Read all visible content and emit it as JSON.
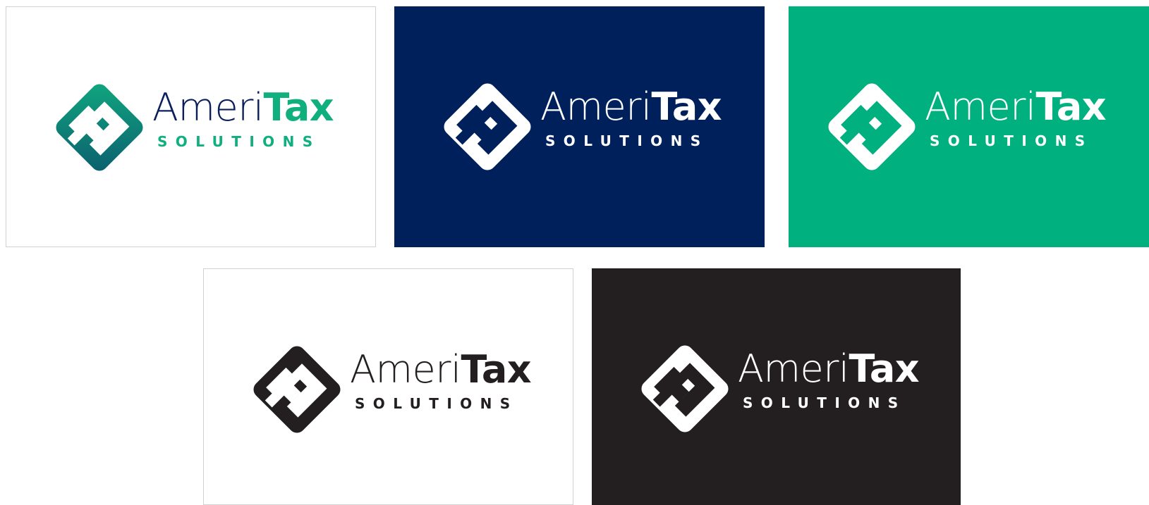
{
  "brand": {
    "name_light": "Ameri",
    "name_bold": "Tax",
    "tagline": "SOLUTIONS"
  },
  "variants": [
    {
      "id": "full-color-on-white",
      "background": "#ffffff",
      "name_light_color": "#0b1f5c",
      "name_bold_color": "#10b07e",
      "tagline_color": "#10b07e",
      "mark_style": "gradient",
      "mark_colors": [
        "#10a77f",
        "#0c5e6e"
      ]
    },
    {
      "id": "white-on-navy",
      "background": "#00205b",
      "name_light_color": "#ffffff",
      "name_bold_color": "#ffffff",
      "tagline_color": "#ffffff",
      "mark_style": "solid",
      "mark_colors": [
        "#ffffff"
      ]
    },
    {
      "id": "white-on-green",
      "background": "#00b07e",
      "name_light_color": "#ffffff",
      "name_bold_color": "#ffffff",
      "tagline_color": "#ffffff",
      "mark_style": "solid",
      "mark_colors": [
        "#ffffff"
      ]
    },
    {
      "id": "black-on-white",
      "background": "#ffffff",
      "name_light_color": "#231f20",
      "name_bold_color": "#231f20",
      "tagline_color": "#231f20",
      "mark_style": "solid",
      "mark_colors": [
        "#231f20"
      ]
    },
    {
      "id": "white-on-black",
      "background": "#231f20",
      "name_light_color": "#ffffff",
      "name_bold_color": "#ffffff",
      "tagline_color": "#ffffff",
      "mark_style": "solid",
      "mark_colors": [
        "#ffffff"
      ]
    }
  ]
}
